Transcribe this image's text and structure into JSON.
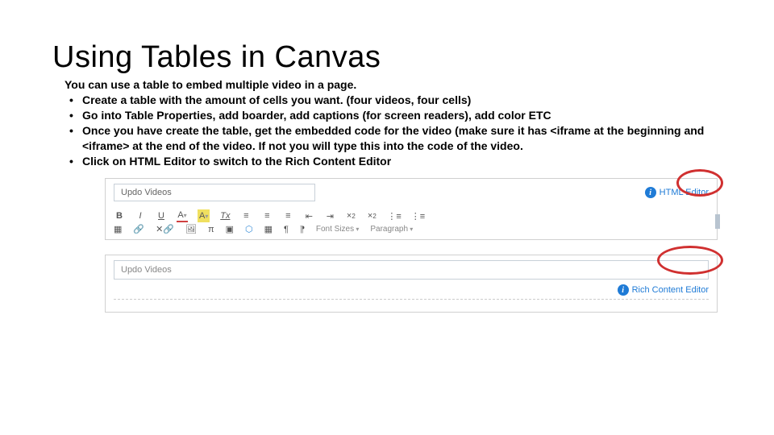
{
  "title": "Using Tables in Canvas",
  "intro": "You can use a table to embed multiple video in a page.",
  "bullets": [
    "Create a table with the amount of cells you want. (four videos, four cells)",
    "Go into Table Properties, add boarder, add captions (for screen readers), add color ETC",
    "Once you have create the table, get the embedded code for the video (make sure it has <iframe at the beginning and <iframe> at the end of the video. If not you will type this into the code of the video.",
    "Click on HTML Editor to switch to the Rich Content Editor"
  ],
  "shot1": {
    "title_value": "Updo Videos",
    "link": "HTML Editor",
    "toolbar": {
      "bold": "B",
      "italic": "I",
      "underline": "U",
      "fontcolor": "A",
      "bgcolor": "A",
      "clear": "Tx",
      "align_l": "≡",
      "align_c": "≡",
      "align_r": "≡",
      "indent_out": "⇤",
      "indent_in": "⇥",
      "super": "×",
      "sub": "×",
      "ul": "⋮≡",
      "ol": "⋮≡",
      "table": "▦",
      "link": "🔗",
      "unlink": "✕🔗",
      "image": "🖼",
      "equation": "π",
      "media": "▣",
      "cloud": "⬡",
      "record": "▦",
      "ltr": "¶",
      "rtl": "¶",
      "fontsize": "Font Sizes",
      "paragraph": "Paragraph"
    }
  },
  "shot2": {
    "title_value": "Updo Videos",
    "link": "Rich Content Editor"
  }
}
